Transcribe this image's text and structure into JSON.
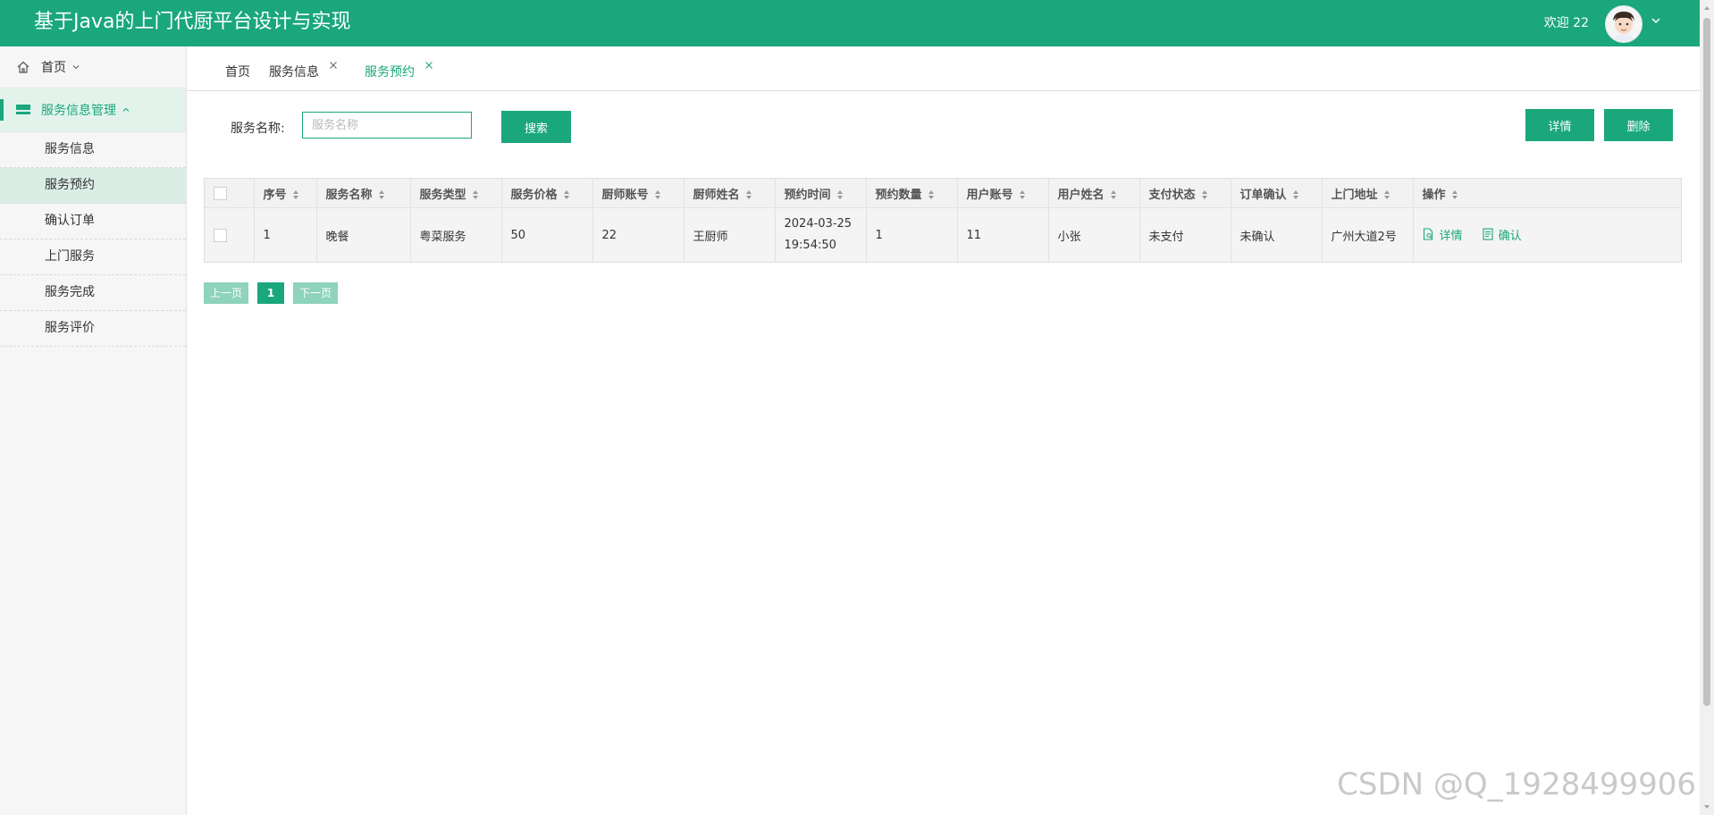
{
  "header": {
    "title": "基于Java的上门代厨平台设计与实现",
    "welcome": "欢迎 22",
    "bg_color": "#1aa77b"
  },
  "sidebar": {
    "home_label": "首页",
    "group_label": "服务信息管理",
    "items": [
      {
        "label": "服务信息"
      },
      {
        "label": "服务预约"
      },
      {
        "label": "确认订单"
      },
      {
        "label": "上门服务"
      },
      {
        "label": "服务完成"
      },
      {
        "label": "服务评价"
      }
    ]
  },
  "tabs": [
    {
      "label": "首页"
    },
    {
      "label": "服务信息"
    },
    {
      "label": "服务预约"
    }
  ],
  "search": {
    "label": "服务名称:",
    "placeholder": "服务名称",
    "button": "搜索"
  },
  "actions": {
    "detail": "详情",
    "delete": "删除"
  },
  "table": {
    "headers": [
      "序号",
      "服务名称",
      "服务类型",
      "服务价格",
      "厨师账号",
      "厨师姓名",
      "预约时间",
      "预约数量",
      "用户账号",
      "用户姓名",
      "支付状态",
      "订单确认",
      "上门地址",
      "操作"
    ],
    "rows": [
      {
        "index": "1",
        "service_name": "晚餐",
        "service_type": "粤菜服务",
        "price": "50",
        "chef_account": "22",
        "chef_name": "王厨师",
        "time_date": "2024-03-25",
        "time_clock": "19:54:50",
        "quantity": "1",
        "user_account": "11",
        "user_name": "小张",
        "pay_status": "未支付",
        "order_confirm": "未确认",
        "address": "广州大道2号",
        "op_detail": "详情",
        "op_confirm": "确认"
      }
    ]
  },
  "pagination": {
    "prev": "上一页",
    "current": "1",
    "next": "下一页"
  },
  "watermark": "CSDN @Q_1928499906"
}
